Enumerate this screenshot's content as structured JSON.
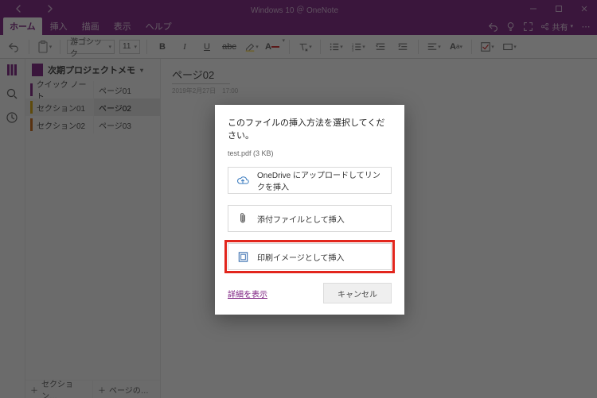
{
  "titlebar": {
    "title": "Windows 10 ＠ OneNote"
  },
  "menu": {
    "tabs": [
      "ホーム",
      "挿入",
      "描画",
      "表示",
      "ヘルプ"
    ],
    "share": "共有"
  },
  "ribbon": {
    "font_name": "游ゴシック",
    "font_size": "11"
  },
  "nav": {
    "notebook": "次期プロジェクトメモ",
    "sections": [
      "クイック ノート",
      "セクション01",
      "セクション02"
    ],
    "pages": [
      "ページ01",
      "ページ02",
      "ページ03"
    ],
    "add_section": "セクション…",
    "add_page": "ページの…"
  },
  "page": {
    "title": "ページ02",
    "date": "2019年2月27日　17:00"
  },
  "dialog": {
    "title": "このファイルの挿入方法を選択してください。",
    "file": "test.pdf (3 KB)",
    "options": [
      "OneDrive にアップロードしてリンクを挿入",
      "添付ファイルとして挿入",
      "印刷イメージとして挿入"
    ],
    "details": "詳細を表示",
    "cancel": "キャンセル"
  }
}
